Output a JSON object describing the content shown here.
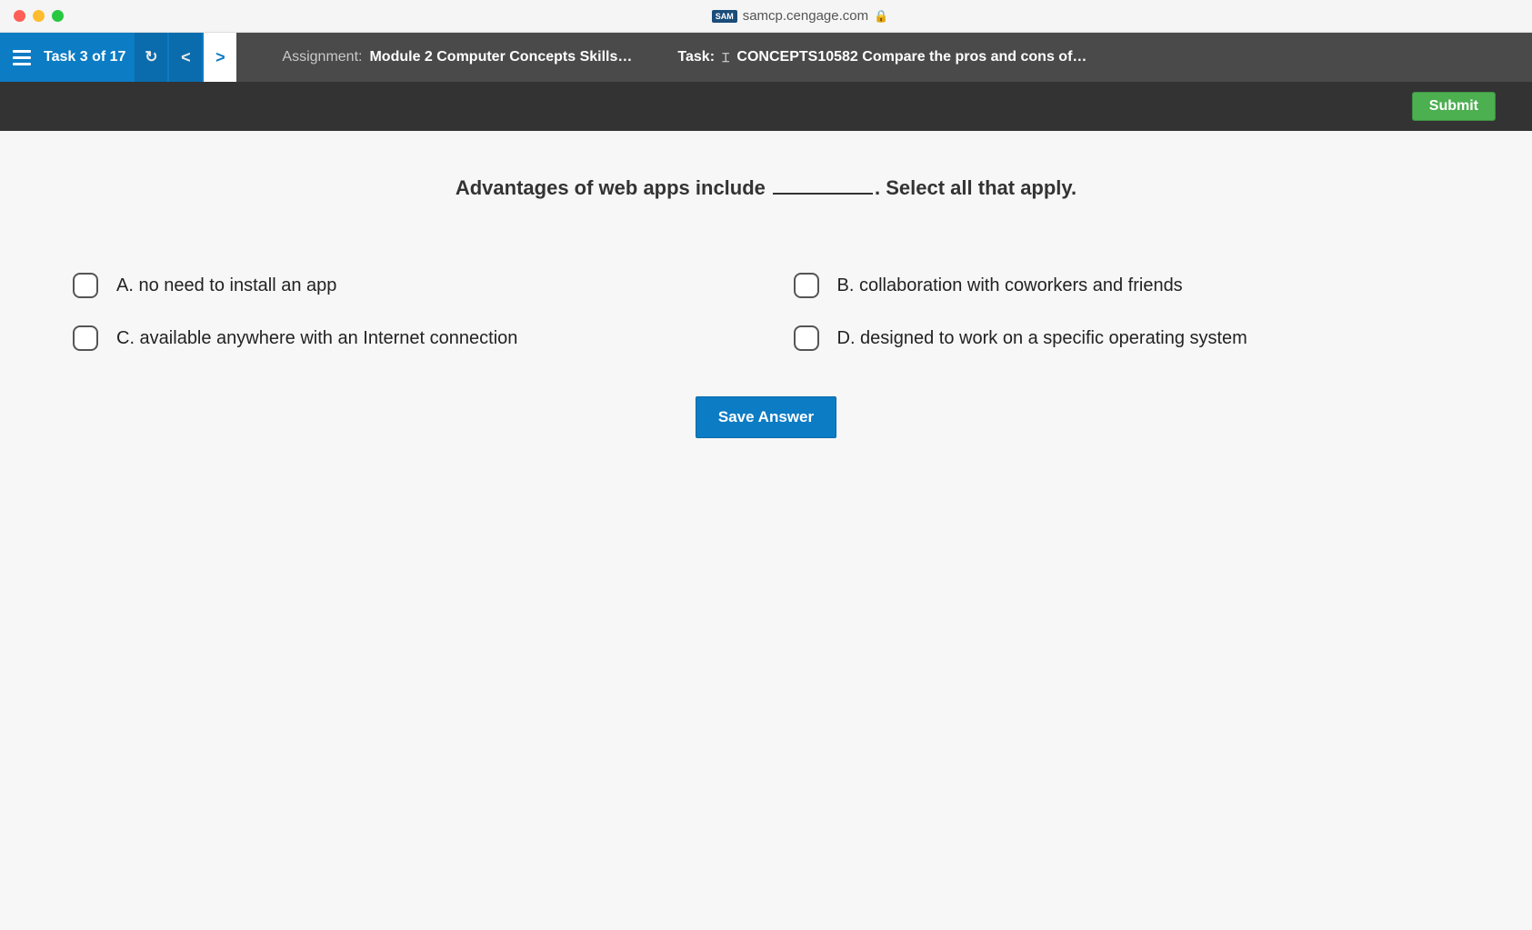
{
  "browser": {
    "url": "samcp.cengage.com",
    "badge": "SAM"
  },
  "header": {
    "task_progress": "Task 3 of 17",
    "assignment_label": "Assignment:",
    "assignment_value": "Module 2 Computer Concepts Skills…",
    "task_label": "Task:",
    "task_value": "CONCEPTS10582 Compare the pros and cons of…"
  },
  "submit_label": "Submit",
  "question": {
    "prefix": "Advantages of web apps include ",
    "suffix": ". Select all that apply."
  },
  "options": {
    "a": "A. no need to install an app",
    "b": "B. collaboration with coworkers and friends",
    "c": "C. available anywhere with an Internet connection",
    "d": "D. designed to work on a specific operating system"
  },
  "save_label": "Save Answer"
}
